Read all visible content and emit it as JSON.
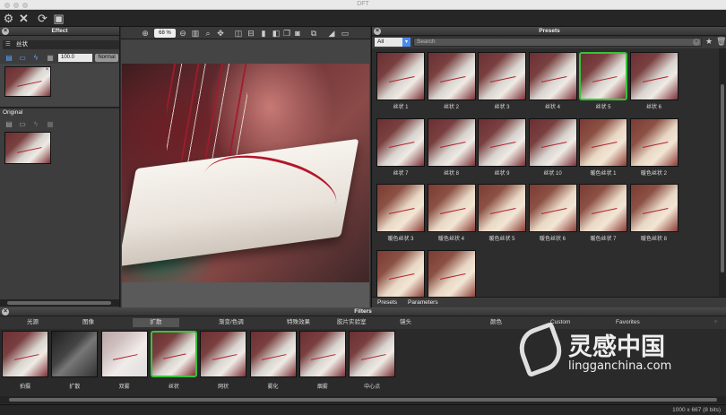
{
  "window": {
    "title": "DFT"
  },
  "toolbar": {
    "icons": [
      "gear-icon",
      "close-icon",
      "refresh-icon",
      "fit-icon"
    ]
  },
  "effect_panel": {
    "title": "Effect",
    "effect_name": "丝状",
    "opacity_value": "100.0",
    "blend_mode": "Normal",
    "original_title": "Original"
  },
  "preview": {
    "zoom": "68 %"
  },
  "presets_panel": {
    "title": "Presets",
    "category": "All",
    "search_placeholder": "Search",
    "items": [
      {
        "label": "丝状 1",
        "style": "normal"
      },
      {
        "label": "丝状 2",
        "style": "normal"
      },
      {
        "label": "丝状 3",
        "style": "normal"
      },
      {
        "label": "丝状 4",
        "style": "normal"
      },
      {
        "label": "丝状 5",
        "style": "selected"
      },
      {
        "label": "丝状 6",
        "style": "normal"
      },
      {
        "label": "丝状 7",
        "style": "normal"
      },
      {
        "label": "丝状 8",
        "style": "normal"
      },
      {
        "label": "丝状 9",
        "style": "normal"
      },
      {
        "label": "丝状 10",
        "style": "normal"
      },
      {
        "label": "暖色丝状 1",
        "style": "warm"
      },
      {
        "label": "暖色丝状 2",
        "style": "warm"
      },
      {
        "label": "暖色丝状 3",
        "style": "warm"
      },
      {
        "label": "暖色丝状 4",
        "style": "warm"
      },
      {
        "label": "暖色丝状 5",
        "style": "warm"
      },
      {
        "label": "暖色丝状 6",
        "style": "warm"
      },
      {
        "label": "暖色丝状 7",
        "style": "warm"
      },
      {
        "label": "暖色丝状 8",
        "style": "warm"
      },
      {
        "label": "",
        "style": "warm"
      },
      {
        "label": "",
        "style": "warm"
      }
    ],
    "tabs": [
      "Presets",
      "Parameters"
    ]
  },
  "filters": {
    "title": "Filters",
    "categories": [
      "光源",
      "图像",
      "扩散",
      "渐变/色调",
      "特殊效果",
      "胶片实验室",
      "镜头",
      "颜色",
      "Custom",
      "Favorites"
    ],
    "active_category": "扩散",
    "items": [
      {
        "label": "拍摄",
        "style": "normal"
      },
      {
        "label": "扩散",
        "style": "gray"
      },
      {
        "label": "双雾",
        "style": "hazy"
      },
      {
        "label": "丝状",
        "style": "selected"
      },
      {
        "label": "网状",
        "style": "normal"
      },
      {
        "label": "雾化",
        "style": "normal"
      },
      {
        "label": "烟雾",
        "style": "normal"
      },
      {
        "label": "中心点",
        "style": "normal"
      }
    ]
  },
  "status": {
    "image_info": "1000 x 667 (8 bits)"
  },
  "watermark": {
    "brand": "灵感中国",
    "url": "lingganchina.com"
  },
  "colors": {
    "selected_border": "#3ac23a",
    "accent_blue": "#4a8cf0"
  }
}
